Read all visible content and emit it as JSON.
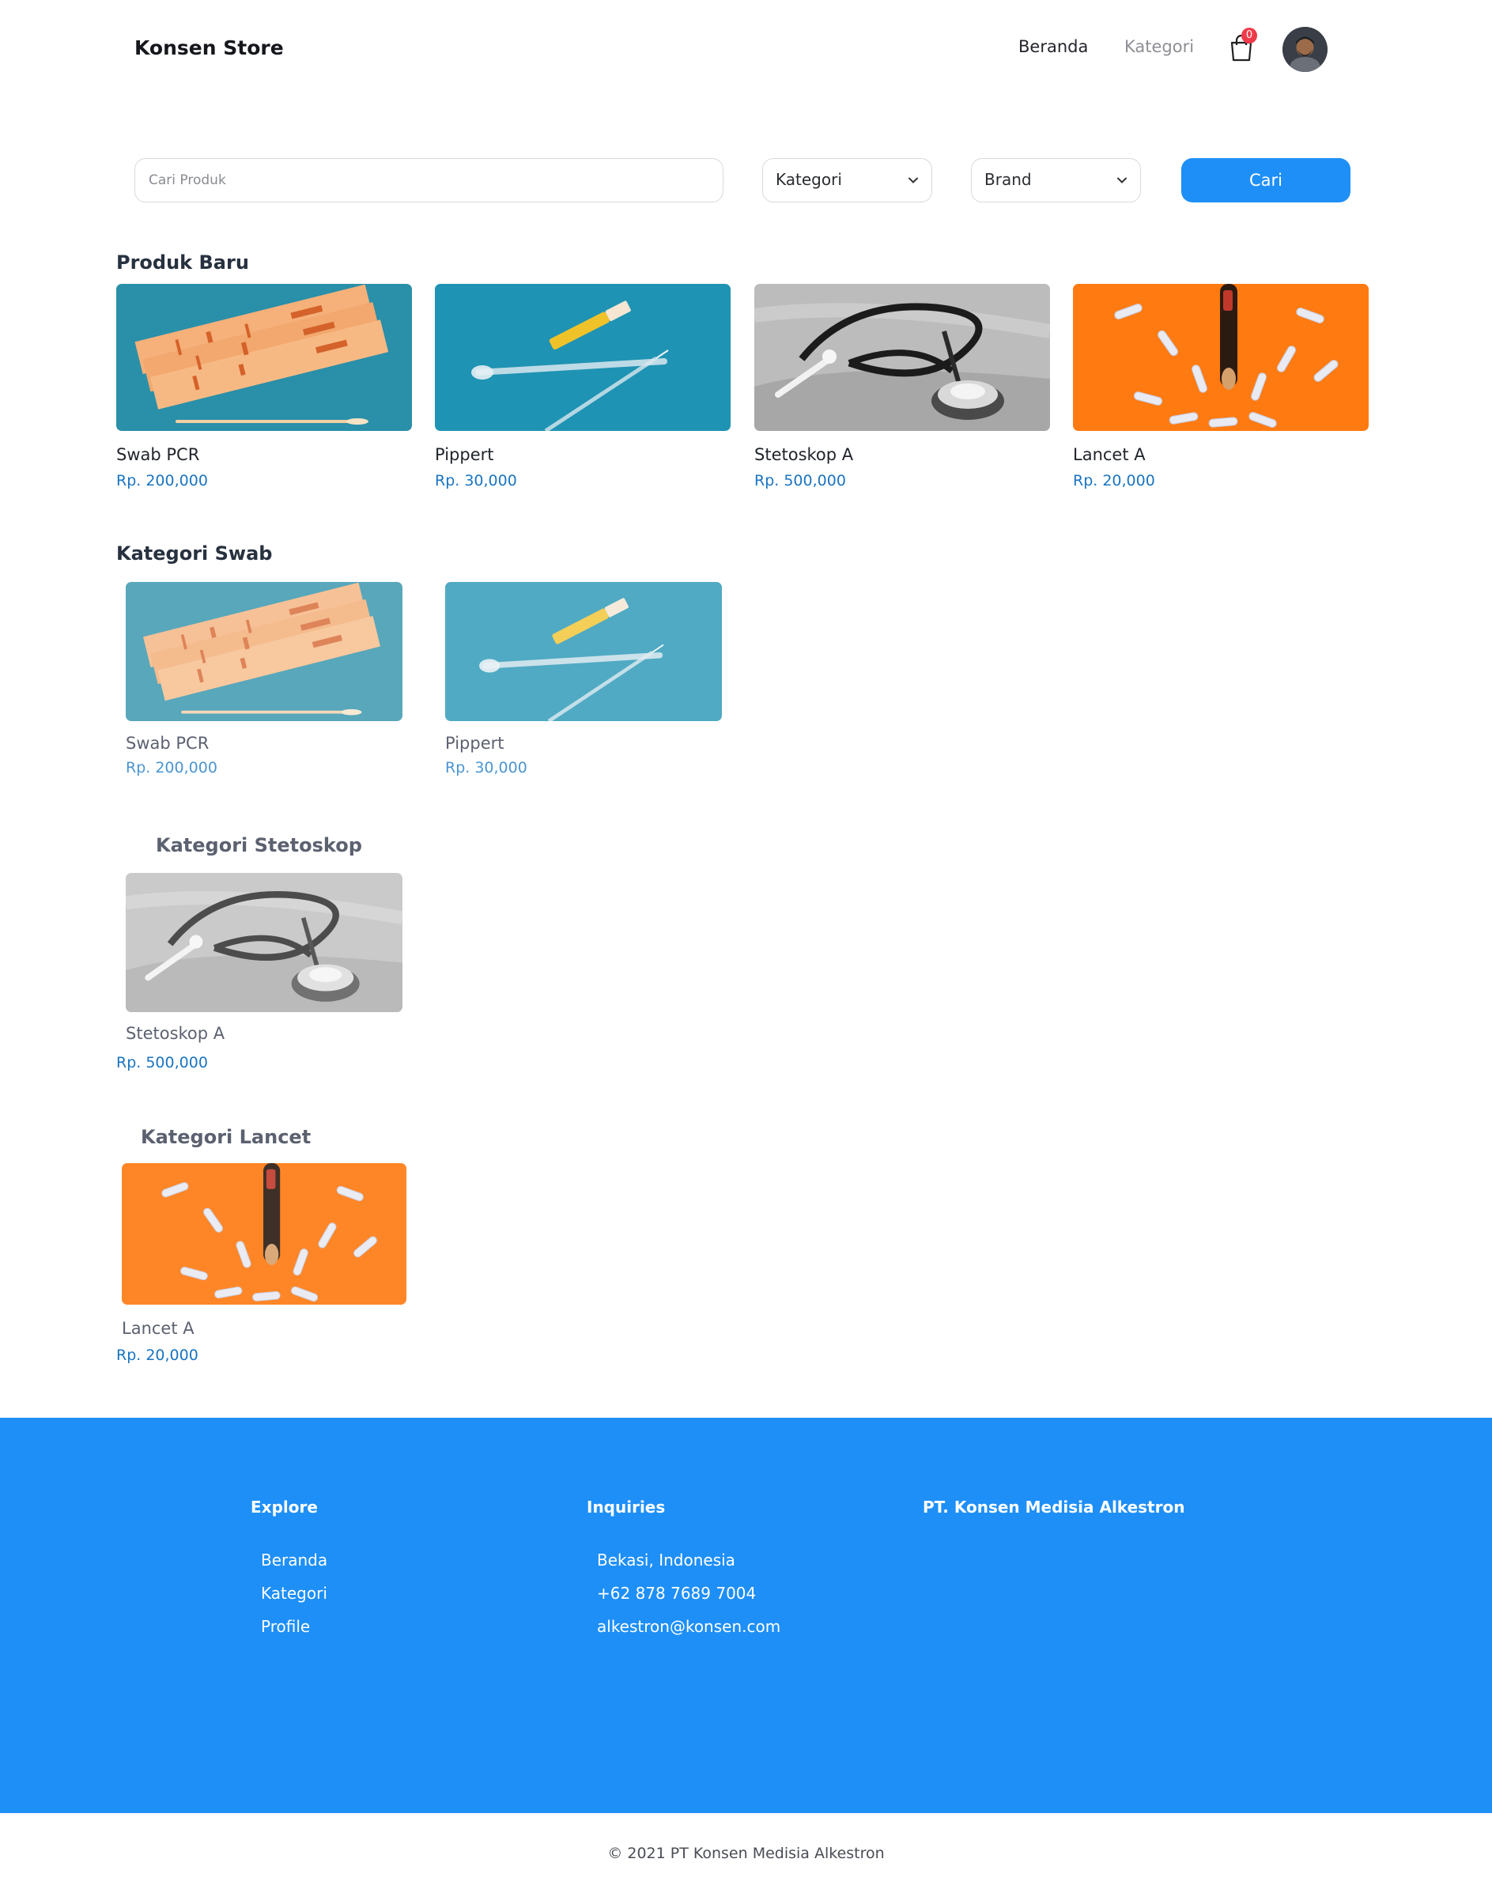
{
  "header": {
    "brand": "Konsen Store",
    "nav": {
      "home": "Beranda",
      "category": "Kategori"
    },
    "cart_count": "0",
    "accent_color": "#1e8ff7"
  },
  "search": {
    "placeholder": "Cari Produk",
    "category_select": "Kategori",
    "brand_select": "Brand",
    "button": "Cari"
  },
  "sections": {
    "new": {
      "title": "Produk Baru",
      "items": [
        {
          "name": "Swab PCR",
          "price": "Rp. 200,000",
          "image": "swab-image"
        },
        {
          "name": "Pippert",
          "price": "Rp. 30,000",
          "image": "pipette-image"
        },
        {
          "name": "Stetoskop A",
          "price": "Rp. 500,000",
          "image": "stethoscope-image"
        },
        {
          "name": "Lancet A",
          "price": "Rp. 20,000",
          "image": "lancet-image"
        }
      ]
    },
    "swab": {
      "title": "Kategori Swab",
      "items": [
        {
          "name": "Swab PCR",
          "price": "Rp. 200,000"
        },
        {
          "name": "Pippert",
          "price": "Rp. 30,000"
        }
      ]
    },
    "stethoscope": {
      "title": "Kategori Stetoskop",
      "items": [
        {
          "name": "Stetoskop A",
          "price": "Rp. 500,000"
        }
      ]
    },
    "lancet": {
      "title": "Kategori Lancet",
      "items": [
        {
          "name": "Lancet A",
          "price": "Rp. 20,000"
        }
      ]
    }
  },
  "footer": {
    "explore": {
      "title": "Explore",
      "links": [
        "Beranda",
        "Kategori",
        "Profile"
      ]
    },
    "inquiries": {
      "title": "Inquiries",
      "lines": [
        "Bekasi, Indonesia",
        "+62 878 7689 7004",
        "alkestron@konsen.com"
      ]
    },
    "company": {
      "title": "PT. Konsen Medisia Alkestron"
    },
    "copyright": "© 2021 PT Konsen Medisia Alkestron"
  }
}
